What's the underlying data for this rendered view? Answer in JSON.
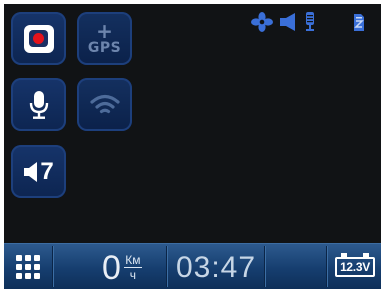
{
  "tiles": {
    "record": {
      "icon": "record-icon"
    },
    "gps": {
      "icon": "plus-icon",
      "label": "GPS"
    },
    "microphone": {
      "icon": "microphone-icon"
    },
    "wifi": {
      "icon": "wifi-icon"
    },
    "volume": {
      "icon": "speaker-icon",
      "level": "7"
    }
  },
  "status_bar": {
    "icons": [
      "fan-icon",
      "speaker-icon",
      "microphone-icon",
      "sd-card-icon"
    ],
    "accent_color": "#2f62c8"
  },
  "bottom_bar": {
    "menu_icon": "grid-menu-icon",
    "speed": {
      "value": "0",
      "unit_top": "Км",
      "unit_bottom": "ч"
    },
    "time": "03:47",
    "voltage": "12.3V",
    "battery_icon": "battery-icon"
  },
  "colors": {
    "background": "#111315",
    "tile": "#16346a",
    "record_red": "#e5131b",
    "bar_blue": "#1c4679"
  }
}
